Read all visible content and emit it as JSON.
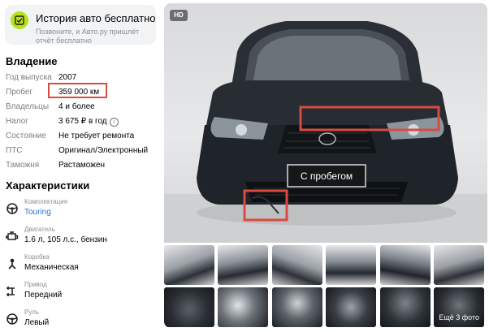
{
  "promo": {
    "title": "История авто бесплатно",
    "subtitle": "Позвоните, и Авто.ру пришлёт отчёт бесплатно",
    "icon": "check-document-icon",
    "accent": "#b7e21a"
  },
  "ownership": {
    "title": "Владение",
    "rows": [
      {
        "label": "Год выпуска",
        "value": "2007"
      },
      {
        "label": "Пробег",
        "value": "359 000 км"
      },
      {
        "label": "Владельцы",
        "value": "4 и более"
      },
      {
        "label": "Налог",
        "value": "3 675 ₽ в год"
      },
      {
        "label": "Состояние",
        "value": "Не требует ремонта"
      },
      {
        "label": "ПТС",
        "value": "Оригинал/Электронный"
      },
      {
        "label": "Таможня",
        "value": "Растаможен"
      }
    ],
    "info_glyph": "i",
    "highlight_color": "#d94a3f"
  },
  "specs": {
    "title": "Характеристики",
    "items": [
      {
        "label": "Комплектация",
        "value": "Touring",
        "icon": "steering-wheel-icon"
      },
      {
        "label": "Двигатель",
        "value": "1.6 л, 105 л.с., бензин",
        "icon": "engine-icon"
      },
      {
        "label": "Коробка",
        "value": "Механическая",
        "icon": "gearbox-icon"
      },
      {
        "label": "Привод",
        "value": "Передний",
        "icon": "drivetrain-icon"
      },
      {
        "label": "Руль",
        "value": "Левый",
        "icon": "steering-wheel-icon"
      }
    ],
    "link_color": "#2b73d6"
  },
  "gallery": {
    "hd_badge": "HD",
    "plate_text": "С пробегом",
    "more_photos_label": "Ещё 3 фото"
  }
}
